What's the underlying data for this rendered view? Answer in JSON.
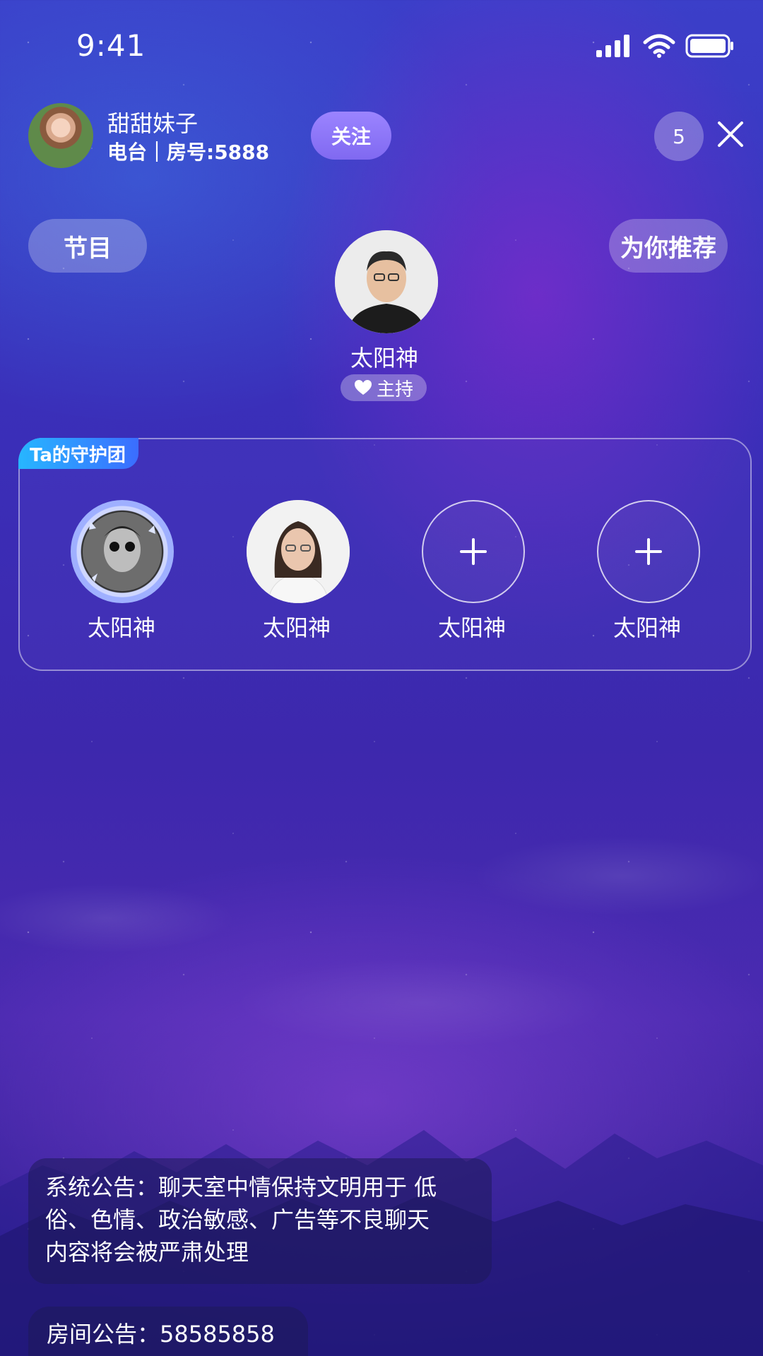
{
  "status_bar": {
    "time": "9:41"
  },
  "header": {
    "host_name": "甜甜妹子",
    "host_sub": "电台｜房号:5888",
    "follow_label": "关注",
    "viewer_count": "5"
  },
  "pills": {
    "program": "节目",
    "recommend": "为你推荐"
  },
  "host_seat": {
    "name": "太阳神",
    "tag": "主持"
  },
  "guardians": {
    "title": "Ta的守护团",
    "slots": [
      {
        "name": "太阳神"
      },
      {
        "name": "太阳神"
      },
      {
        "name": "太阳神"
      },
      {
        "name": "太阳神"
      }
    ]
  },
  "announcements": {
    "system_line1": "系统公告：聊天室中情保持文明用于 低",
    "system_line2": "俗、色情、政治敏感、广告等不良聊天",
    "system_line3": "内容将会被严肃处理",
    "room": "房间公告：58585858"
  },
  "icons": [
    "signal-icon",
    "wifi-icon",
    "battery-icon",
    "close-icon",
    "heart-icon",
    "plus-icon"
  ]
}
